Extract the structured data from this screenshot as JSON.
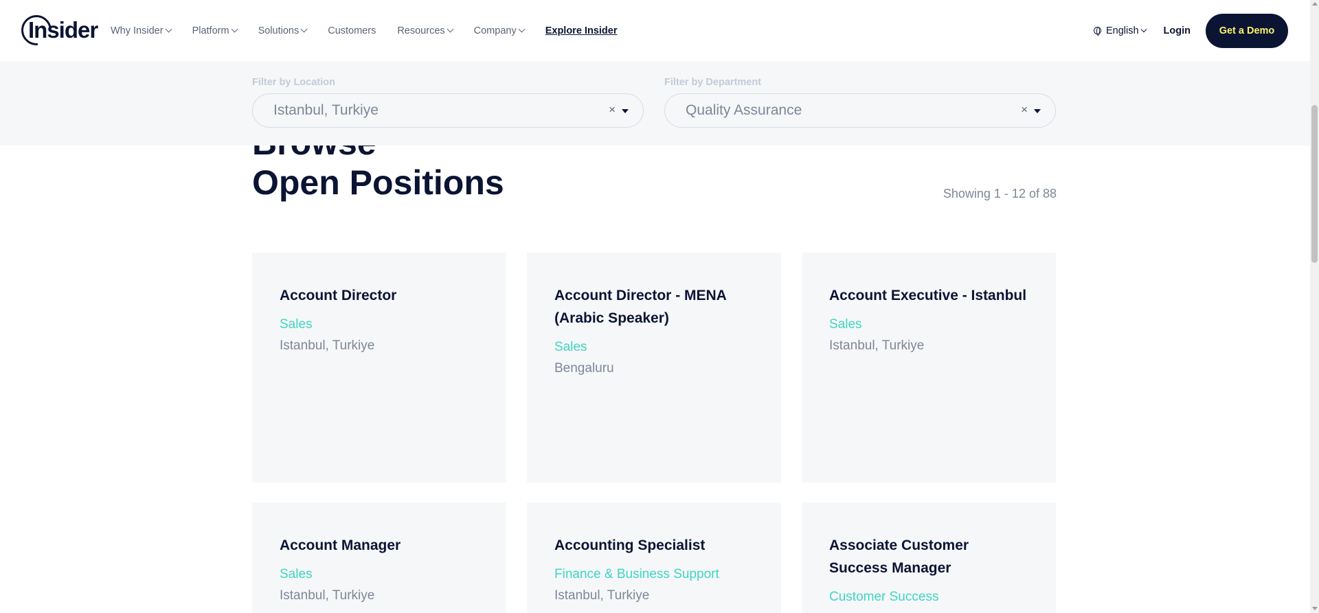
{
  "header": {
    "logo_text": "Insider",
    "nav": [
      {
        "label": "Why Insider",
        "has_dropdown": true
      },
      {
        "label": "Platform",
        "has_dropdown": true
      },
      {
        "label": "Solutions",
        "has_dropdown": true
      },
      {
        "label": "Customers",
        "has_dropdown": false
      },
      {
        "label": "Resources",
        "has_dropdown": true
      },
      {
        "label": "Company",
        "has_dropdown": true
      }
    ],
    "explore_label": "Explore Insider",
    "language": "English",
    "login_label": "Login",
    "demo_label": "Get a Demo"
  },
  "filters": {
    "location": {
      "label": "Filter by Location",
      "value": "Istanbul, Turkiye",
      "clear": "×"
    },
    "department": {
      "label": "Filter by Department",
      "value": "Quality Assurance",
      "clear": "×"
    }
  },
  "main": {
    "heading_line1": "Browse",
    "heading_line2": "Open Positions",
    "showing": "Showing 1 - 12 of 88"
  },
  "positions": [
    {
      "title": "Account Director",
      "department": "Sales",
      "location": "Istanbul, Turkiye"
    },
    {
      "title": "Account Director - MENA (Arabic Speaker)",
      "department": "Sales",
      "location": "Bengaluru"
    },
    {
      "title": "Account Executive - Istanbul",
      "department": "Sales",
      "location": "Istanbul, Turkiye"
    },
    {
      "title": "Account Manager",
      "department": "Sales",
      "location": "Istanbul, Turkiye"
    },
    {
      "title": "Accounting Specialist",
      "department": "Finance & Business Support",
      "location": "Istanbul, Turkiye"
    },
    {
      "title": "Associate Customer Success Manager",
      "department": "Customer Success",
      "location": ""
    }
  ],
  "colors": {
    "brand_dark": "#0b1433",
    "accent_yellow": "#fff36b",
    "department_teal": "#3fd5c0",
    "muted_text": "#7d8797",
    "card_bg": "#f5f7f9"
  }
}
